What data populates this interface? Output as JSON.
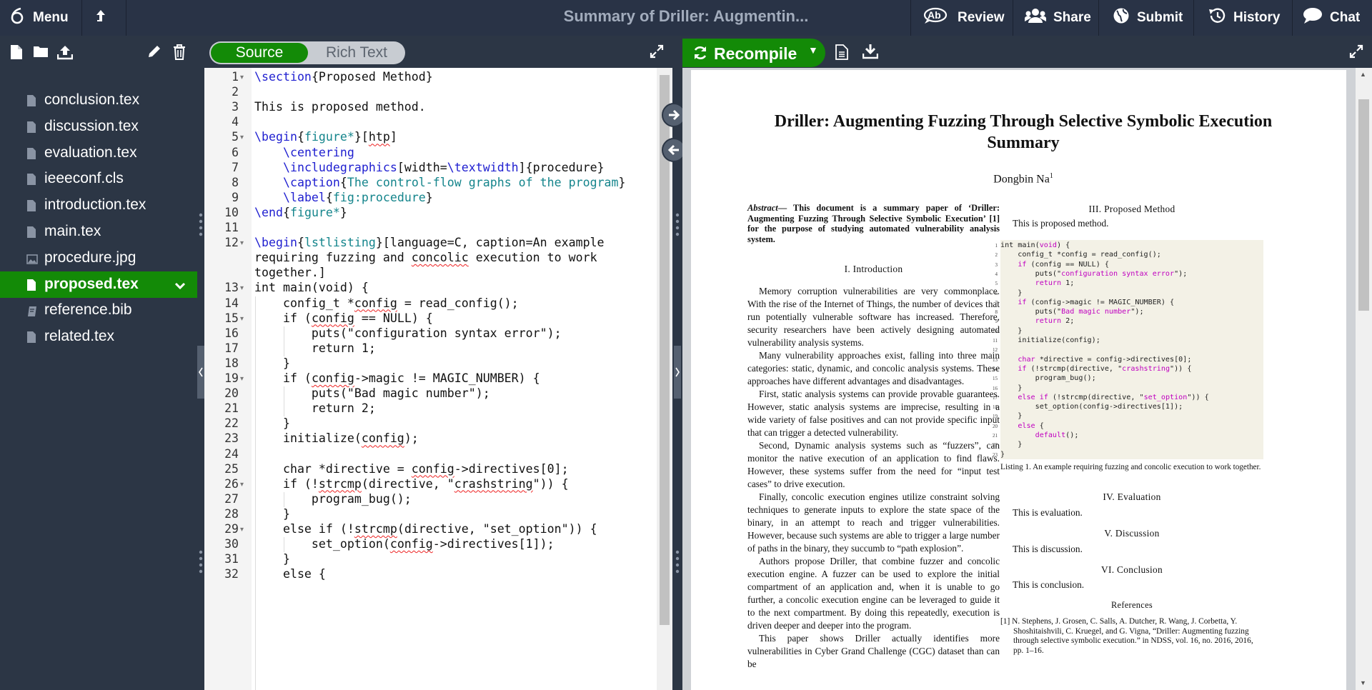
{
  "topbar": {
    "menu_label": "Menu",
    "title": "Summary of Driller: Augmentin...",
    "review_label": "Review",
    "share_label": "Share",
    "submit_label": "Submit",
    "history_label": "History",
    "chat_label": "Chat"
  },
  "files": [
    {
      "name": "conclusion.tex",
      "icon": "file-icon"
    },
    {
      "name": "discussion.tex",
      "icon": "file-icon"
    },
    {
      "name": "evaluation.tex",
      "icon": "file-icon"
    },
    {
      "name": "ieeeconf.cls",
      "icon": "file-icon"
    },
    {
      "name": "introduction.tex",
      "icon": "file-icon"
    },
    {
      "name": "main.tex",
      "icon": "file-icon"
    },
    {
      "name": "procedure.jpg",
      "icon": "image-icon"
    },
    {
      "name": "proposed.tex",
      "icon": "file-icon",
      "selected": true
    },
    {
      "name": "reference.bib",
      "icon": "bib-icon"
    },
    {
      "name": "related.tex",
      "icon": "file-icon"
    }
  ],
  "editor": {
    "mode_source": "Source",
    "mode_rich": "Rich Text",
    "line_numbers": [
      "1",
      "2",
      "3",
      "4",
      "5",
      "6",
      "7",
      "8",
      "9",
      "10",
      "11",
      "12",
      "",
      "",
      "13",
      "14",
      "15",
      "16",
      "17",
      "18",
      "19",
      "20",
      "21",
      "22",
      "23",
      "24",
      "25",
      "26",
      "27",
      "28",
      "29",
      "30",
      "31",
      "32"
    ],
    "lines": [
      "\\section{Proposed Method}",
      "",
      "This is proposed method.",
      "",
      "\\begin{figure*}[htp]",
      "    \\centering",
      "    \\includegraphics[width=\\textwidth]{procedure}",
      "    \\caption{The control-flow graphs of the program}",
      "    \\label{fig:procedure}",
      "\\end{figure*}",
      "",
      "\\begin{lstlisting}[language=C, caption=An example",
      "requiring fuzzing and concolic execution to work",
      "together.]",
      "int main(void) {",
      "    config_t *config = read_config();",
      "    if (config == NULL) {",
      "        puts(\"configuration syntax error\");",
      "        return 1;",
      "    }",
      "    if (config->magic != MAGIC_NUMBER) {",
      "        puts(\"Bad magic number\");",
      "        return 2;",
      "    }",
      "    initialize(config);",
      "",
      "    char *directive = config->directives[0];",
      "    if (!strcmp(directive, \"crashstring\")) {",
      "        program_bug();",
      "    }",
      "    else if (!strcmp(directive, \"set_option\")) {",
      "        set_option(config->directives[1]);",
      "    }",
      "    else {"
    ]
  },
  "pdf_toolbar": {
    "recompile_label": "Recompile"
  },
  "pdf": {
    "title_line1": "Driller: Augmenting Fuzzing Through Selective Symbolic Execution",
    "title_line2": "Summary",
    "author": "Dongbin Na",
    "author_sup": "1",
    "abstract_label": "Abstract",
    "abstract_text": "— This document is a summary paper of ‘Driller: Augmenting Fuzzing Through Selective Symbolic Execution’ [1] for the purpose of studying automated vulnerability analysis system.",
    "intro_heading": "I. Introduction",
    "intro_paragraphs": [
      "Memory corruption vulnerabilities are very commonplace. With the rise of the Internet of Things, the number of devices that run potentially vulnerable software has increased. Therefore, security researchers have been actively designing automated vulnerability analysis systems.",
      "Many vulnerability approaches exist, falling into three main categories: static, dynamic, and concolic analysis systems. These approaches have different advantages and disadvantages.",
      "First, static analysis systems can provide provable guarantees. However, static analysis systems are imprecise, resulting in a wide variety of false positives and can not provide specific input that can trigger a detected vulnerability.",
      "Second, Dynamic analysis systems such as “fuzzers”, can monitor the native execution of an application to find flaws. However, these systems suffer from the need for “input test cases” to drive execution.",
      "Finally, concolic execution engines utilize constraint solving techniques to generate inputs to explore the state space of the binary, in an attempt to reach and trigger vulnerabilities. However, because such systems are able to trigger a large number of paths in the binary, they succumb to “path explosion”.",
      "Authors propose Driller, that combine fuzzer and concolic execution engine. A fuzzer can be used to explore the initial compartment of an application and, when it is unable to go further, a concolic execution engine can be leveraged to guide it to the next compartment. By doing this repeatedly, execution is driven deeper and deeper into the program.",
      "This paper shows Driller actually identifies more vulnerabilities in Cyber Grand Challenge (CGC) dataset than can be"
    ],
    "proposed_heading": "III. Proposed Method",
    "proposed_text": "This is proposed method.",
    "listing_lines": [
      "int main(void) {",
      "    config_t *config = read_config();",
      "    if (config == NULL) {",
      "        puts(\"configuration syntax error\");",
      "        return 1;",
      "    }",
      "    if (config->magic != MAGIC_NUMBER) {",
      "        puts(\"Bad magic number\");",
      "        return 2;",
      "    }",
      "    initialize(config);",
      "",
      "    char *directive = config->directives[0];",
      "    if (!strcmp(directive, \"crashstring\")) {",
      "        program_bug();",
      "    }",
      "    else if (!strcmp(directive, \"set_option\")) {",
      "        set_option(config->directives[1]);",
      "    }",
      "    else {",
      "        default();",
      "    }",
      "}"
    ],
    "listing_caption": "Listing 1.   An example requiring fuzzing and concolic execution to work together.",
    "eval_heading": "IV. Evaluation",
    "eval_text": "This is evaluation.",
    "disc_heading": "V. Discussion",
    "disc_text": "This is discussion.",
    "concl_heading": "VI. Conclusion",
    "concl_text": "This is conclusion.",
    "ref_heading": "References",
    "ref_1": "[1]  N. Stephens, J. Grosen, C. Salls, A. Dutcher, R. Wang, J. Corbetta, Y. Shoshitaishvili, C. Kruegel, and G. Vigna, “Driller: Augmenting fuzzing through selective symbolic execution.” in NDSS, vol. 16, no. 2016, 2016, pp. 1–16."
  }
}
